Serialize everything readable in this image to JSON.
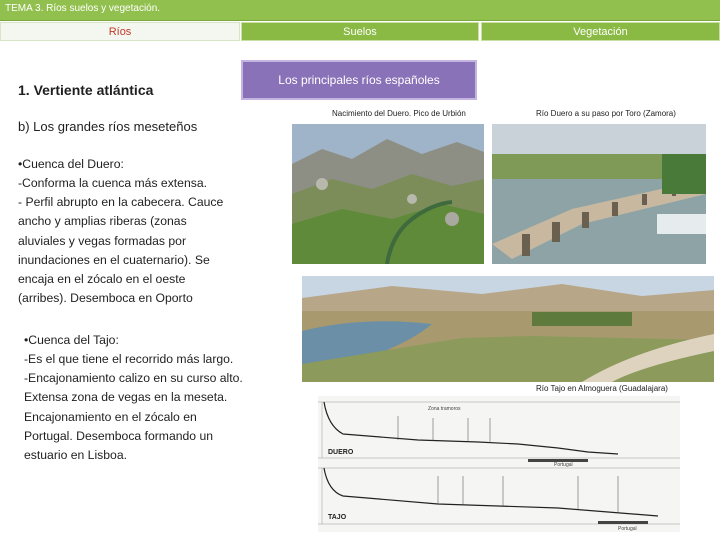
{
  "header": {
    "title": "TEMA 3. Ríos suelos y vegetación."
  },
  "tabs": [
    {
      "label": "Ríos",
      "active": true
    },
    {
      "label": "Suelos",
      "active": false
    },
    {
      "label": "Vegetación",
      "active": false
    }
  ],
  "content": {
    "section_title": "1. Vertiente atlántica",
    "subtitle": "b) Los grandes ríos meseteños",
    "duero": {
      "heading": "•Cuenca del Duero:",
      "body": "-Conforma la cuenca más extensa.\n- Perfil abrupto en la cabecera. Cauce\nancho y amplias riberas (zonas\naluviales y vegas formadas por\ninundaciones en el cuaternario). Se\nencaja en el zócalo en el oeste\n(arribes). Desemboca en Oporto"
    },
    "tajo": {
      "heading": "•Cuenca del Tajo:",
      "body": "-Es el que tiene el recorrido más largo.\n-Encajonamiento calizo en su curso alto.\nExtensa zona de vegas en la meseta.\nEncajonamiento en el zócalo en\nPortugal. Desemboca formando un\nestuario en Lisboa."
    }
  },
  "banner": {
    "label": "Los principales ríos españoles"
  },
  "captions": {
    "photo1": "Nacimiento del Duero. Pico de Urbión",
    "photo2": "Río Duero a su paso por Toro (Zamora)",
    "photo3": "Río Tajo en Almoguera (Guadalajara)"
  },
  "profile": {
    "duero_label": "DUERO",
    "tajo_label": "TAJO",
    "zone_top": "Zona tramoros",
    "portugal_label": "Portugal"
  },
  "colors": {
    "topbar": "#92c04e",
    "tab": "#8aba44",
    "banner": "#8a72b9",
    "active_tab_text": "#c0392b"
  }
}
